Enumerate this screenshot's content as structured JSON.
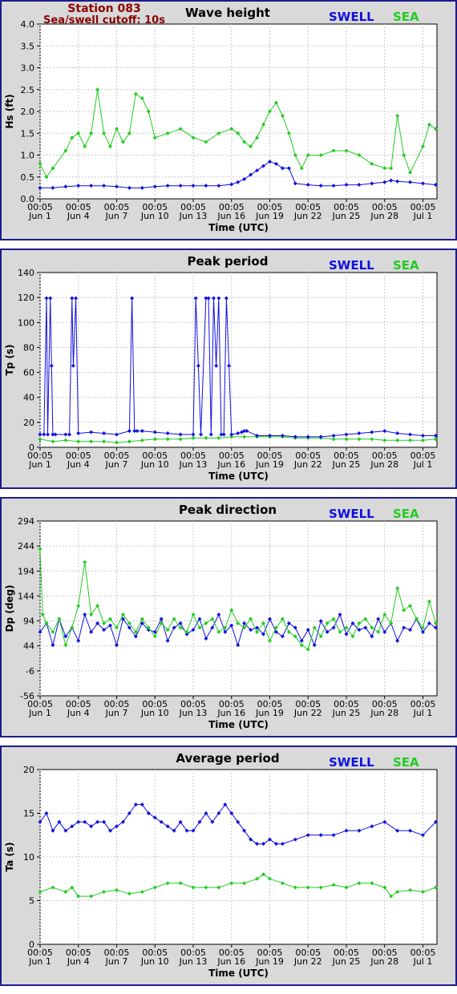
{
  "station": {
    "title": "Station 083",
    "cutoff": "Sea/swell cutoff: 10s"
  },
  "legend": {
    "swell": "SWELL",
    "sea": "SEA"
  },
  "colors": {
    "swell": "#1010e0",
    "sea": "#22cc22"
  },
  "xaxis": {
    "label": "Time (UTC)",
    "ticks": [
      {
        "day": 1,
        "time": "00:05",
        "date": "Jun 1"
      },
      {
        "day": 4,
        "time": "00:05",
        "date": "Jun 4"
      },
      {
        "day": 7,
        "time": "00:05",
        "date": "Jun 7"
      },
      {
        "day": 10,
        "time": "00:05",
        "date": "Jun 10"
      },
      {
        "day": 13,
        "time": "00:05",
        "date": "Jun 13"
      },
      {
        "day": 16,
        "time": "00:05",
        "date": "Jun 16"
      },
      {
        "day": 19,
        "time": "00:05",
        "date": "Jun 19"
      },
      {
        "day": 22,
        "time": "00:05",
        "date": "Jun 22"
      },
      {
        "day": 25,
        "time": "00:05",
        "date": "Jun 25"
      },
      {
        "day": 28,
        "time": "00:05",
        "date": "Jun 28"
      },
      {
        "day": 31,
        "time": "00:05",
        "date": "Jul 1"
      }
    ]
  },
  "chart_data": [
    {
      "type": "line",
      "title": "Wave height",
      "ylabel": "Hs (ft)",
      "xlim": [
        1,
        32.1
      ],
      "ylim": [
        0,
        4
      ],
      "yticks": [
        "0.0",
        "0.5",
        "1.0",
        "1.5",
        "2.0",
        "2.5",
        "3.0",
        "3.5",
        "4.0"
      ],
      "series": [
        {
          "name": "SWELL",
          "x": [
            1,
            2,
            3,
            4,
            5,
            6,
            7,
            8,
            9,
            10,
            11,
            12,
            13,
            14,
            15,
            16,
            16.5,
            17,
            17.5,
            18,
            18.5,
            19,
            19.5,
            20,
            20.5,
            21,
            22,
            23,
            24,
            25,
            26,
            27,
            28,
            28.5,
            29,
            30,
            31,
            32
          ],
          "y": [
            0.25,
            0.25,
            0.28,
            0.3,
            0.3,
            0.3,
            0.28,
            0.25,
            0.25,
            0.28,
            0.3,
            0.3,
            0.3,
            0.3,
            0.3,
            0.33,
            0.38,
            0.45,
            0.55,
            0.65,
            0.75,
            0.85,
            0.8,
            0.7,
            0.7,
            0.35,
            0.32,
            0.3,
            0.3,
            0.32,
            0.32,
            0.35,
            0.38,
            0.42,
            0.4,
            0.38,
            0.35,
            0.32
          ]
        },
        {
          "name": "SEA",
          "x": [
            1,
            1.5,
            2,
            3,
            3.5,
            4,
            4.5,
            5,
            5.5,
            6,
            6.5,
            7,
            7.5,
            8,
            8.5,
            9,
            9.5,
            10,
            11,
            12,
            13,
            14,
            15,
            16,
            16.5,
            17,
            17.5,
            18,
            18.5,
            19,
            19.5,
            20,
            20.5,
            21,
            21.5,
            22,
            23,
            24,
            25,
            26,
            27,
            28,
            28.5,
            29,
            29.5,
            30,
            31,
            31.5,
            32
          ],
          "y": [
            0.8,
            0.5,
            0.7,
            1.1,
            1.4,
            1.5,
            1.2,
            1.5,
            2.5,
            1.5,
            1.2,
            1.6,
            1.3,
            1.5,
            2.4,
            2.3,
            2.0,
            1.4,
            1.5,
            1.6,
            1.4,
            1.3,
            1.5,
            1.6,
            1.5,
            1.3,
            1.2,
            1.4,
            1.7,
            2.0,
            2.2,
            1.9,
            1.5,
            1.0,
            0.7,
            1.0,
            1.0,
            1.1,
            1.1,
            1.0,
            0.8,
            0.7,
            0.7,
            1.9,
            1.0,
            0.6,
            1.2,
            1.7,
            1.6
          ]
        }
      ]
    },
    {
      "type": "line",
      "title": "Peak period",
      "ylabel": "Tp (s)",
      "xlim": [
        1,
        32.1
      ],
      "ylim": [
        0,
        150
      ],
      "yticks": [
        "0",
        "20",
        "40",
        "60",
        "80",
        "100",
        "120",
        "140"
      ],
      "series": [
        {
          "name": "SWELL",
          "x": [
            1,
            1.3,
            1.5,
            1.6,
            1.8,
            1.9,
            2.0,
            2.2,
            3.0,
            3.3,
            3.5,
            3.6,
            3.8,
            4.0,
            5,
            6,
            7,
            8,
            8.2,
            8.4,
            8.6,
            9,
            10,
            11,
            12,
            13,
            13.2,
            13.4,
            13.6,
            14,
            14.2,
            14.4,
            14.6,
            14.8,
            15.0,
            15.2,
            15.4,
            15.6,
            15.8,
            16,
            16.5,
            16.8,
            17,
            17.2,
            18,
            19,
            20,
            21,
            22,
            23,
            24,
            25,
            26,
            27,
            28,
            29,
            30,
            31,
            32
          ],
          "y": [
            11,
            11,
            128,
            11,
            128,
            70,
            11,
            11,
            11,
            11,
            128,
            70,
            128,
            12,
            13,
            12,
            11,
            14,
            128,
            14,
            14,
            14,
            13,
            12,
            11,
            11,
            128,
            70,
            11,
            128,
            128,
            11,
            128,
            70,
            128,
            11,
            11,
            128,
            70,
            11,
            12,
            13,
            14,
            14,
            10,
            10,
            10,
            9,
            9,
            9,
            10,
            11,
            12,
            13,
            14,
            12,
            11,
            10,
            10
          ]
        },
        {
          "name": "SEA",
          "x": [
            1,
            2,
            3,
            4,
            5,
            6,
            7,
            8,
            9,
            10,
            11,
            12,
            13,
            14,
            15,
            16,
            17,
            18,
            19,
            20,
            21,
            22,
            23,
            24,
            25,
            26,
            27,
            28,
            29,
            30,
            31,
            32
          ],
          "y": [
            7,
            5,
            6,
            5,
            5,
            5,
            4,
            5,
            6,
            7,
            7,
            7,
            8,
            8,
            8,
            9,
            9,
            9,
            9,
            9,
            8,
            8,
            8,
            7,
            7,
            7,
            7,
            6,
            6,
            6,
            6,
            7
          ]
        }
      ]
    },
    {
      "type": "line",
      "title": "Peak direction",
      "ylabel": "Dp (deg)",
      "xlim": [
        1,
        32.1
      ],
      "ylim": [
        -56,
        344
      ],
      "yticks": [
        "-56",
        "-6",
        "44",
        "94",
        "144",
        "194",
        "244",
        "294"
      ],
      "series": [
        {
          "name": "SWELL",
          "x": [
            1,
            1.5,
            2,
            2.5,
            3,
            3.5,
            4,
            4.5,
            5,
            5.5,
            6,
            6.5,
            7,
            7.5,
            8,
            8.5,
            9,
            9.5,
            10,
            10.5,
            11,
            11.5,
            12,
            12.5,
            13,
            13.5,
            14,
            14.5,
            15,
            15.5,
            16,
            16.5,
            17,
            17.5,
            18,
            18.5,
            19,
            19.5,
            20,
            20.5,
            21,
            21.5,
            22,
            22.5,
            23,
            23.5,
            24,
            24.5,
            25,
            25.5,
            26,
            26.5,
            27,
            27.5,
            28,
            28.5,
            29,
            29.5,
            30,
            30.5,
            31,
            31.5,
            32
          ],
          "y": [
            90,
            110,
            60,
            120,
            80,
            100,
            70,
            130,
            90,
            110,
            95,
            105,
            60,
            120,
            100,
            80,
            110,
            95,
            90,
            120,
            70,
            100,
            110,
            85,
            95,
            120,
            75,
            100,
            130,
            90,
            105,
            60,
            110,
            95,
            100,
            85,
            120,
            90,
            80,
            110,
            100,
            70,
            95,
            60,
            115,
            90,
            100,
            130,
            85,
            110,
            95,
            100,
            80,
            120,
            90,
            110,
            70,
            100,
            95,
            120,
            90,
            110,
            100
          ]
        },
        {
          "name": "SEA",
          "x": [
            1,
            1.2,
            1.5,
            2,
            2.5,
            3,
            3.5,
            4,
            4.5,
            5,
            5.5,
            6,
            6.5,
            7,
            7.5,
            8,
            8.5,
            9,
            9.5,
            10,
            10.5,
            11,
            11.5,
            12,
            12.5,
            13,
            13.5,
            14,
            14.5,
            15,
            15.5,
            16,
            16.5,
            17,
            17.5,
            18,
            18.5,
            19,
            19.5,
            20,
            20.5,
            21,
            21.5,
            22,
            22.5,
            23,
            23.5,
            24,
            24.5,
            25,
            25.5,
            26,
            26.5,
            27,
            27.5,
            28,
            28.5,
            29,
            29.5,
            30,
            30.5,
            31,
            31.5,
            32
          ],
          "y": [
            280,
            130,
            110,
            90,
            120,
            60,
            100,
            150,
            250,
            130,
            150,
            110,
            120,
            100,
            130,
            110,
            90,
            120,
            100,
            80,
            110,
            95,
            120,
            100,
            90,
            130,
            100,
            110,
            120,
            90,
            100,
            140,
            110,
            100,
            120,
            90,
            110,
            70,
            100,
            120,
            90,
            80,
            60,
            50,
            100,
            80,
            110,
            120,
            90,
            100,
            80,
            110,
            120,
            100,
            90,
            130,
            110,
            190,
            140,
            150,
            120,
            100,
            160,
            110
          ]
        }
      ]
    },
    {
      "type": "line",
      "title": "Average period",
      "ylabel": "Ta (s)",
      "xlim": [
        1,
        32.1
      ],
      "ylim": [
        0,
        20
      ],
      "yticks": [
        "0",
        "5",
        "10",
        "15",
        "20"
      ],
      "series": [
        {
          "name": "SWELL",
          "x": [
            1,
            1.5,
            2,
            2.5,
            3,
            3.5,
            4,
            4.5,
            5,
            5.5,
            6,
            6.5,
            7,
            7.5,
            8,
            8.5,
            9,
            9.5,
            10,
            10.5,
            11,
            11.5,
            12,
            12.5,
            13,
            13.5,
            14,
            14.5,
            15,
            15.5,
            16,
            16.5,
            17,
            17.5,
            18,
            18.5,
            19,
            19.5,
            20,
            21,
            22,
            23,
            24,
            25,
            26,
            27,
            28,
            29,
            30,
            31,
            32
          ],
          "y": [
            14,
            15,
            13,
            14,
            13,
            13.5,
            14,
            14,
            13.5,
            14,
            14,
            13,
            13.5,
            14,
            15,
            16,
            16,
            15,
            14.5,
            14,
            13.5,
            13,
            14,
            13,
            13,
            14,
            15,
            14,
            15,
            16,
            15,
            14,
            13,
            12,
            11.5,
            11.5,
            12,
            11.5,
            11.5,
            12,
            12.5,
            12.5,
            12.5,
            13,
            13,
            13.5,
            14,
            13,
            13,
            12.5,
            14
          ]
        },
        {
          "name": "SEA",
          "x": [
            1,
            2,
            3,
            3.5,
            4,
            5,
            6,
            7,
            8,
            9,
            10,
            11,
            12,
            13,
            14,
            15,
            16,
            17,
            18,
            18.5,
            19,
            20,
            21,
            22,
            23,
            24,
            25,
            26,
            27,
            28,
            28.5,
            29,
            30,
            31,
            32
          ],
          "y": [
            6,
            6.5,
            6,
            6.5,
            5.5,
            5.5,
            6,
            6.2,
            5.8,
            6,
            6.5,
            7,
            7,
            6.5,
            6.5,
            6.5,
            7,
            7,
            7.5,
            8,
            7.5,
            7,
            6.5,
            6.5,
            6.5,
            6.8,
            6.5,
            7,
            7,
            6.5,
            5.5,
            6,
            6.2,
            6,
            6.5
          ]
        }
      ]
    }
  ]
}
